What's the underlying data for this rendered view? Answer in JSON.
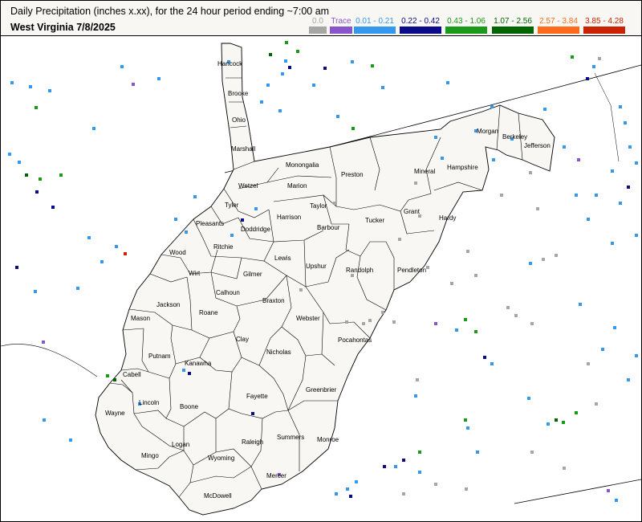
{
  "header": {
    "title": "Daily Precipitation (inches  x.xx),  for the 24 hour period ending ~7:00 am",
    "subtitle": "West Virginia 7/8/2025"
  },
  "legend": [
    {
      "label": "0.0",
      "color": "#a6a6a6",
      "text_color": "#a6a6a6"
    },
    {
      "label": "Trace",
      "color": "#8855cc",
      "text_color": "#8855cc"
    },
    {
      "label": "0.01 - 0.21",
      "color": "#3399ee",
      "text_color": "#3399ee"
    },
    {
      "label": "0.22 - 0.42",
      "color": "#0a0a8a",
      "text_color": "#0a0a8a"
    },
    {
      "label": "0.43 - 1.06",
      "color": "#1a9a1a",
      "text_color": "#1a9a1a"
    },
    {
      "label": "1.07 - 2.56",
      "color": "#006400",
      "text_color": "#006400"
    },
    {
      "label": "2.57 - 3.84",
      "color": "#ff6a1a",
      "text_color": "#ff6a1a"
    },
    {
      "label": "3.85 - 4.28",
      "color": "#cc2200",
      "text_color": "#cc2200"
    }
  ],
  "counties": [
    {
      "name": "Hancock"
    },
    {
      "name": "Brooke"
    },
    {
      "name": "Ohio"
    },
    {
      "name": "Marshall"
    },
    {
      "name": "Wetzel"
    },
    {
      "name": "Monongalia"
    },
    {
      "name": "Preston"
    },
    {
      "name": "Marion"
    },
    {
      "name": "Tyler"
    },
    {
      "name": "Pleasants"
    },
    {
      "name": "Doddridge"
    },
    {
      "name": "Harrison"
    },
    {
      "name": "Taylor"
    },
    {
      "name": "Barbour"
    },
    {
      "name": "Tucker"
    },
    {
      "name": "Wood"
    },
    {
      "name": "Ritchie"
    },
    {
      "name": "Lewis"
    },
    {
      "name": "Upshur"
    },
    {
      "name": "Randolph"
    },
    {
      "name": "Wirt"
    },
    {
      "name": "Gilmer"
    },
    {
      "name": "Calhoun"
    },
    {
      "name": "Jackson"
    },
    {
      "name": "Roane"
    },
    {
      "name": "Braxton"
    },
    {
      "name": "Webster"
    },
    {
      "name": "Mason"
    },
    {
      "name": "Pendleton"
    },
    {
      "name": "Grant"
    },
    {
      "name": "Hardy"
    },
    {
      "name": "Mineral"
    },
    {
      "name": "Hampshire"
    },
    {
      "name": "Morgan"
    },
    {
      "name": "Berkeley"
    },
    {
      "name": "Jefferson"
    },
    {
      "name": "Putnam"
    },
    {
      "name": "Clay"
    },
    {
      "name": "Nicholas"
    },
    {
      "name": "Pocahontas"
    },
    {
      "name": "Cabell"
    },
    {
      "name": "Kanawha"
    },
    {
      "name": "Lincoln"
    },
    {
      "name": "Fayette"
    },
    {
      "name": "Greenbrier"
    },
    {
      "name": "Wayne"
    },
    {
      "name": "Boone"
    },
    {
      "name": "Raleigh"
    },
    {
      "name": "Summers"
    },
    {
      "name": "Monroe"
    },
    {
      "name": "Logan"
    },
    {
      "name": "Mingo"
    },
    {
      "name": "Wyoming"
    },
    {
      "name": "Mercer"
    },
    {
      "name": "McDowell"
    }
  ]
}
